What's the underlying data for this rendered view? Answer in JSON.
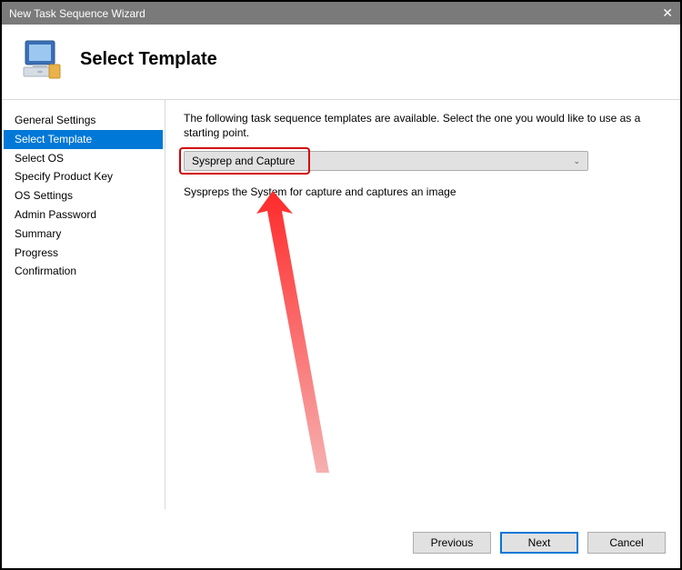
{
  "window": {
    "title": "New Task Sequence Wizard",
    "close_glyph": "✕"
  },
  "header": {
    "title": "Select Template"
  },
  "sidebar": {
    "items": [
      {
        "label": "General Settings",
        "selected": false
      },
      {
        "label": "Select Template",
        "selected": true
      },
      {
        "label": "Select OS",
        "selected": false
      },
      {
        "label": "Specify Product Key",
        "selected": false
      },
      {
        "label": "OS Settings",
        "selected": false
      },
      {
        "label": "Admin Password",
        "selected": false
      },
      {
        "label": "Summary",
        "selected": false
      },
      {
        "label": "Progress",
        "selected": false
      },
      {
        "label": "Confirmation",
        "selected": false
      }
    ]
  },
  "content": {
    "intro": "The following task sequence templates are available.  Select the one you would like to use as a starting point.",
    "dropdown_value": "Sysprep and Capture",
    "description": "Syspreps the System for capture and captures an image"
  },
  "footer": {
    "previous": "Previous",
    "next": "Next",
    "cancel": "Cancel"
  },
  "annotation": {
    "highlight_color": "#d40000"
  }
}
